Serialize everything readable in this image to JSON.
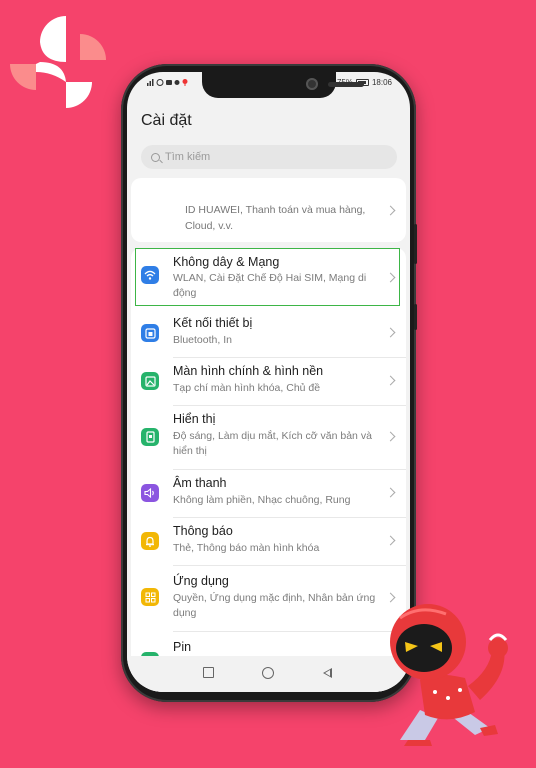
{
  "status_bar": {
    "battery": "75%",
    "time": "18:06"
  },
  "header": {
    "title": "Cài đặt"
  },
  "search": {
    "placeholder": "Tìm kiếm"
  },
  "account": {
    "text": "ID HUAWEI, Thanh toán và mua hàng, Cloud, v.v."
  },
  "settings_items": [
    {
      "label": "Không dây & Mạng",
      "sub": "WLAN, Cài Đặt Chế Độ Hai SIM, Mạng di động",
      "icon": "wifi-icon",
      "color": "#2f7ee6"
    },
    {
      "label": "Kết nối thiết bị",
      "sub": "Bluetooth, In",
      "icon": "device-connection-icon",
      "color": "#2f7ee6"
    },
    {
      "label": "Màn hình chính & hình nền",
      "sub": "Tạp chí màn hình khóa, Chủ đề",
      "icon": "wallpaper-icon",
      "color": "#26b36b"
    },
    {
      "label": "Hiển thị",
      "sub": "Độ sáng, Làm dịu mắt, Kích cỡ văn bản và hiển thị",
      "icon": "display-icon",
      "color": "#26b36b"
    },
    {
      "label": "Âm thanh",
      "sub": "Không làm phiền, Nhạc chuông, Rung",
      "icon": "sound-icon",
      "color": "#8b55e0"
    },
    {
      "label": "Thông báo",
      "sub": "Thẻ, Thông báo màn hình khóa",
      "icon": "notification-icon",
      "color": "#f2b705"
    },
    {
      "label": "Ứng dụng",
      "sub": "Quyền, Ứng dụng mặc định, Nhân bản ứng dụng",
      "icon": "apps-icon",
      "color": "#f2b705"
    },
    {
      "label": "Pin",
      "sub": "",
      "icon": "battery-icon",
      "color": "#26b36b"
    }
  ],
  "colors": {
    "background": "#f5436b",
    "highlight": "#3db546"
  }
}
